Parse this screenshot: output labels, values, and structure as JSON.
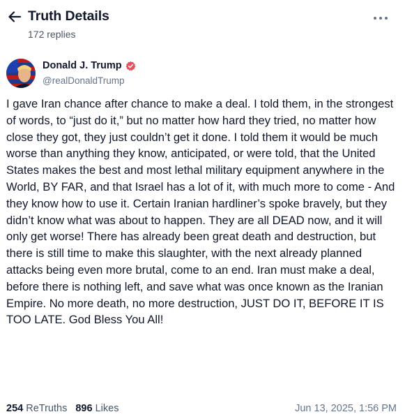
{
  "header": {
    "title": "Truth Details",
    "reply_count": "172 replies",
    "back_icon": "arrow-left-icon",
    "more_icon": "more-horizontal-icon"
  },
  "post": {
    "author_name": "Donald J. Trump",
    "author_handle": "@realDonaldTrump",
    "verified": true,
    "verified_color": "#e8505b",
    "text": "I gave Iran chance after chance to make a deal. I told them, in the strongest of words, to “just do it,” but no matter how hard they tried, no matter how close they got, they just couldn’t get it done. I told them it would be much worse than anything they know, anticipated, or were told, that the United States makes the best and most lethal military equipment anywhere in the World, BY FAR, and that Israel has a lot of it, with much more to come - And they know how to use it. Certain Iranian hardliner’s spoke bravely, but they didn’t know what was about to happen. They are all DEAD now, and it will only get worse! There has already been great death and destruction, but there is still time to make this slaughter, with the next already planned attacks being even more brutal, come to an end. Iran must make a deal, before there is nothing left, and save what was once known as the Iranian Empire. No more death, no more destruction, JUST DO IT, BEFORE IT IS TOO LATE. God Bless You All!"
  },
  "stats": {
    "retruths_count": "254",
    "retruths_label": "ReTruths",
    "likes_count": "896",
    "likes_label": "Likes",
    "timestamp": "Jun 13, 2025, 1:56 PM"
  }
}
